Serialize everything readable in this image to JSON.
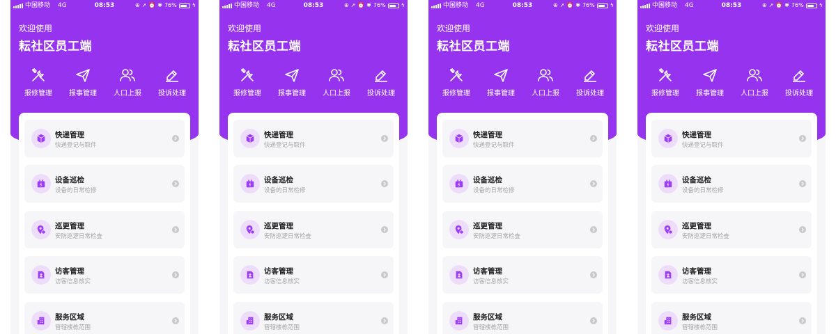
{
  "status_bar": {
    "carrier": "中国移动",
    "network": "4G",
    "time": "08:53",
    "battery_percent": "76%",
    "battery_level": 0.76
  },
  "header": {
    "welcome": "欢迎使用",
    "title": "耘社区员工端"
  },
  "quick_actions": [
    {
      "label": "报修管理",
      "icon": "tools-icon"
    },
    {
      "label": "报事管理",
      "icon": "paper-plane-icon"
    },
    {
      "label": "人口上报",
      "icon": "people-icon"
    },
    {
      "label": "投诉处理",
      "icon": "edit-icon"
    }
  ],
  "menu": [
    {
      "title": "快递管理",
      "subtitle": "快递登记与取件",
      "icon": "package-icon"
    },
    {
      "title": "设备巡检",
      "subtitle": "设备的日常检修",
      "icon": "device-icon"
    },
    {
      "title": "巡更管理",
      "subtitle": "安防巡逻日常检查",
      "icon": "patrol-icon"
    },
    {
      "title": "访客管理",
      "subtitle": "访客信息核实",
      "icon": "visitor-icon"
    },
    {
      "title": "服务区域",
      "subtitle": "管辖楼栋范围",
      "icon": "building-icon"
    }
  ],
  "colors": {
    "primary": "#9533ee",
    "icon_bg": "#eedcfb",
    "icon_fg": "#9b3df0"
  }
}
